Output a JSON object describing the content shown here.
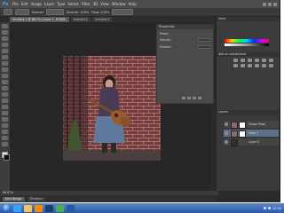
{
  "app": {
    "logo": "Ps",
    "menu": [
      "File",
      "Edit",
      "Image",
      "Layer",
      "Type",
      "Select",
      "Filter",
      "3D",
      "View",
      "Window",
      "Help"
    ]
  },
  "options_bar": {
    "mode_label": "Normal",
    "opacity_label": "Opacity: 100%",
    "flow_label": "Flow: 100%"
  },
  "document_tabs": [
    {
      "label": "Untitled-1 @ 66.7% (Layer 1, RGB/8)",
      "active": true
    },
    {
      "label": "Untitled-2",
      "active": false
    },
    {
      "label": "Untitled-3",
      "active": false
    }
  ],
  "properties_panel": {
    "title": "Properties",
    "header": "Masks",
    "rows": [
      {
        "label": "Density:"
      },
      {
        "label": "Feather:"
      }
    ]
  },
  "right_panels": {
    "tabs": [
      "Color",
      "Swatches",
      "Adjustments",
      "Styles",
      "Layers"
    ],
    "adjustments_title": "Add an adjustment"
  },
  "layers": [
    {
      "name": "Shape Mask",
      "selected": false
    },
    {
      "name": "Mask 1",
      "selected": true
    },
    {
      "name": "Layer 0",
      "selected": false
    }
  ],
  "status": {
    "text": "66.67%"
  },
  "bottom_tabs": [
    "Mini Bridge",
    "Timeline"
  ],
  "taskbar": {
    "icons": [
      {
        "name": "ie-icon",
        "color": "#3aa0ff"
      },
      {
        "name": "folder-icon",
        "color": "#f2c55a"
      },
      {
        "name": "media-player-icon",
        "color": "#ff8a00"
      },
      {
        "name": "photoshop-icon",
        "color": "#1c3f73"
      },
      {
        "name": "chrome-icon",
        "color": "#4caf50"
      },
      {
        "name": "word-icon",
        "color": "#2b579a"
      }
    ],
    "clock": "12:00"
  }
}
